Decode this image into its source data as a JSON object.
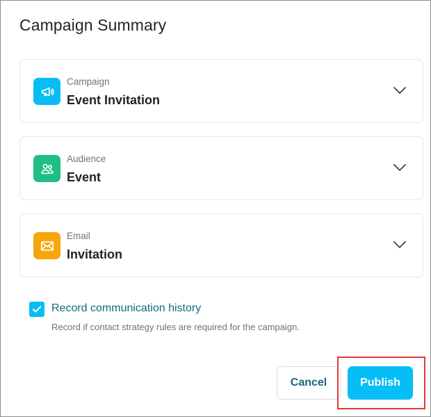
{
  "dialog": {
    "title": "Campaign Summary"
  },
  "cards": [
    {
      "label": "Campaign",
      "value": "Event Invitation",
      "icon": "megaphone-icon",
      "color": "#07bdf4"
    },
    {
      "label": "Audience",
      "value": "Event",
      "icon": "people-icon",
      "color": "#1fbf84"
    },
    {
      "label": "Email",
      "value": "Invitation",
      "icon": "envelope-icon",
      "color": "#f6a609"
    }
  ],
  "record_history": {
    "label": "Record communication history",
    "help": "Record if contact strategy rules are required for the campaign.",
    "checked": true,
    "color": "#06bdf5"
  },
  "actions": {
    "cancel_label": "Cancel",
    "publish_label": "Publish",
    "publish_color": "#06bdf5",
    "highlight_color": "#e53935"
  }
}
